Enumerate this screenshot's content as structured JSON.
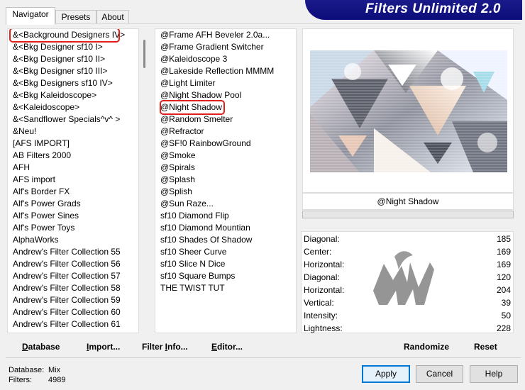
{
  "tabs": [
    "Navigator",
    "Presets",
    "About"
  ],
  "banner": {
    "title": "Filters Unlimited 2.0"
  },
  "categories": [
    "&<Background Designers IV>",
    "&<Bkg Designer sf10 I>",
    "&<Bkg Designer sf10 II>",
    "&<Bkg Designer sf10 III>",
    "&<Bkg Designers sf10 IV>",
    "&<Bkg Kaleidoscope>",
    "&<Kaleidoscope>",
    "&<Sandflower Specials^v^ >",
    "&Neu!",
    "[AFS IMPORT]",
    "AB Filters 2000",
    "AFH",
    "AFS import",
    "Alf's Border FX",
    "Alf's Power Grads",
    "Alf's Power Sines",
    "Alf's Power Toys",
    "AlphaWorks",
    "Andrew's Filter Collection 55",
    "Andrew's Filter Collection 56",
    "Andrew's Filter Collection 57",
    "Andrew's Filter Collection 58",
    "Andrew's Filter Collection 59",
    "Andrew's Filter Collection 60",
    "Andrew's Filter Collection 61"
  ],
  "filters": [
    "@Frame AFH Beveler 2.0a...",
    "@Frame Gradient Switcher",
    "@Kaleidoscope 3",
    "@Lakeside Reflection MMMM",
    "@Light Limiter",
    "@Night Shadow Pool",
    "@Night Shadow",
    "@Random Smelter",
    "@Refractor",
    "@SF!0 RainbowGround",
    "@Smoke",
    "@Spirals",
    "@Splash",
    "@Splish",
    "@Sun Raze...",
    "sf10 Diamond Flip",
    "sf10 Diamond Mountian",
    "sf10 Shades Of Shadow",
    "sf10 Sheer Curve",
    "sf10 Slice N Dice",
    "sf10 Square Bumps",
    "THE TWIST TUT"
  ],
  "selected_filter_name": "@Night Shadow",
  "params": [
    {
      "label": "Diagonal:",
      "value": "185"
    },
    {
      "label": "Center:",
      "value": "169"
    },
    {
      "label": "Horizontal:",
      "value": "169"
    },
    {
      "label": "Diagonal:",
      "value": "120"
    },
    {
      "label": "Horizontal:",
      "value": "204"
    },
    {
      "label": "Vertical:",
      "value": "39"
    },
    {
      "label": "Intensity:",
      "value": "50"
    },
    {
      "label": "Lightness:",
      "value": "228"
    }
  ],
  "actions": {
    "database": "atabase",
    "database_u": "D",
    "import": "mport...",
    "import_u": "I",
    "filter_info": "Filter ",
    "filter_info_u": "I",
    "filter_info_rest": "nfo...",
    "editor": "ditor...",
    "editor_u": "E",
    "randomize": "Randomize",
    "reset": "Reset"
  },
  "status": {
    "database_label": "Database:",
    "database_value": "Mix",
    "filters_label": "Filters:",
    "filters_value": "4989"
  },
  "buttons": {
    "apply": "Apply",
    "cancel": "Cancel",
    "help": "Help"
  },
  "colors": {
    "banner": "#12128a",
    "highlight": "#e0201a",
    "default_button": "#0078d7"
  },
  "icons": {
    "watermark": "watermark-logo-icon"
  }
}
